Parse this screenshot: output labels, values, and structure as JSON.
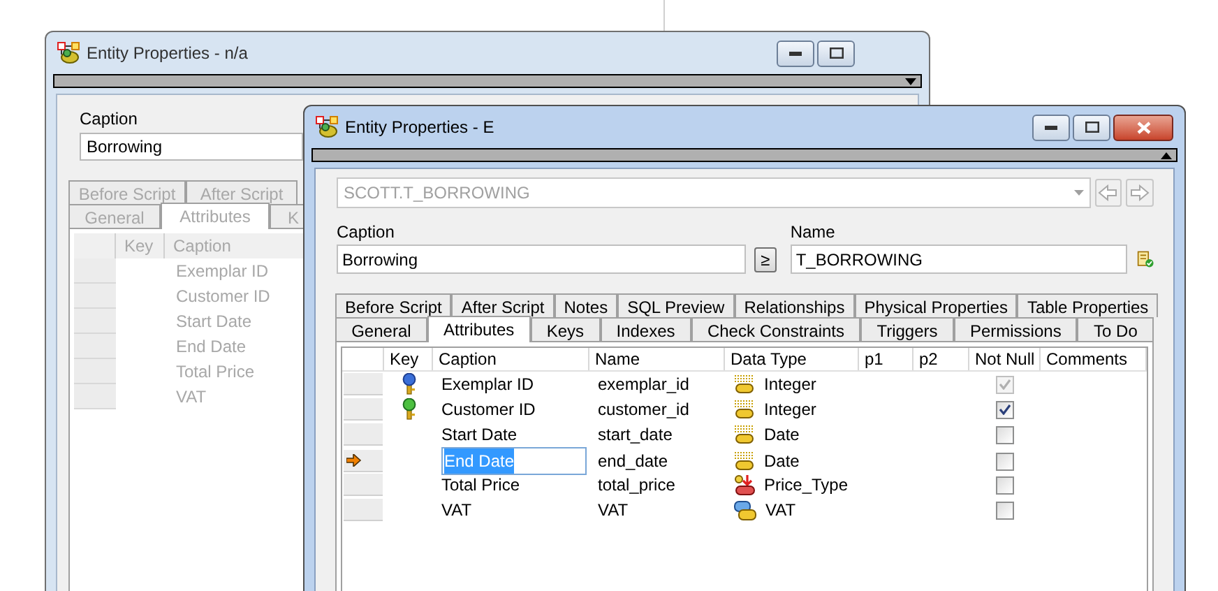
{
  "back_window": {
    "title": "Entity Properties - n/a",
    "active": false,
    "caption": {
      "label": "Caption",
      "value": "Borrowing"
    },
    "tabs_top": [
      {
        "label": "Before Script",
        "selected": false
      },
      {
        "label": "After Script",
        "selected": false
      }
    ],
    "tabs_bottom": [
      {
        "label": "General",
        "selected": false
      },
      {
        "label": "Attributes",
        "selected": true
      },
      {
        "label": "K",
        "selected": false
      }
    ],
    "columns": [
      "Key",
      "Caption"
    ],
    "rows": [
      {
        "caption": "Exemplar ID"
      },
      {
        "caption": "Customer ID"
      },
      {
        "caption": "Start Date"
      },
      {
        "caption": "End Date"
      },
      {
        "caption": "Total Price"
      },
      {
        "caption": "VAT"
      }
    ]
  },
  "front_window": {
    "title": "Entity Properties - E",
    "active": true,
    "object_combo": {
      "value": "SCOTT.T_BORROWING",
      "disabled": true
    },
    "caption": {
      "label": "Caption",
      "value": "Borrowing"
    },
    "copy_button": "≥",
    "name": {
      "label": "Name",
      "value": "T_BORROWING"
    },
    "tabs_top": [
      {
        "label": "Before Script",
        "selected": false
      },
      {
        "label": "After Script",
        "selected": false
      },
      {
        "label": "Notes",
        "selected": false
      },
      {
        "label": "SQL Preview",
        "selected": false
      },
      {
        "label": "Relationships",
        "selected": false
      },
      {
        "label": "Physical Properties",
        "selected": false
      },
      {
        "label": "Table Properties",
        "selected": false
      }
    ],
    "tabs_bottom": [
      {
        "label": "General",
        "selected": false
      },
      {
        "label": "Attributes",
        "selected": true
      },
      {
        "label": "Keys",
        "selected": false
      },
      {
        "label": "Indexes",
        "selected": false
      },
      {
        "label": "Check Constraints",
        "selected": false
      },
      {
        "label": "Triggers",
        "selected": false
      },
      {
        "label": "Permissions",
        "selected": false
      },
      {
        "label": "To Do",
        "selected": false
      }
    ],
    "columns": [
      "Key",
      "Caption",
      "Name",
      "Data Type",
      "p1",
      "p2",
      "Not Null",
      "Comments"
    ],
    "rows": [
      {
        "primary_key": true,
        "foreign_key": false,
        "caption": "Exemplar ID",
        "name": "exemplar_id",
        "kind": "domain",
        "data_type": "Integer",
        "not_null": true,
        "not_null_disabled": true,
        "current": false
      },
      {
        "primary_key": false,
        "foreign_key": true,
        "caption": "Customer ID",
        "name": "customer_id",
        "kind": "domain",
        "data_type": "Integer",
        "not_null": true,
        "not_null_disabled": false,
        "current": false
      },
      {
        "primary_key": false,
        "foreign_key": false,
        "caption": "Start Date",
        "name": "start_date",
        "kind": "domain",
        "data_type": "Date",
        "not_null": false,
        "not_null_disabled": false,
        "current": false
      },
      {
        "primary_key": false,
        "foreign_key": false,
        "caption": "End Date",
        "name": "end_date",
        "kind": "domain",
        "data_type": "Date",
        "not_null": false,
        "not_null_disabled": false,
        "current": true
      },
      {
        "primary_key": false,
        "foreign_key": false,
        "caption": "Total Price",
        "name": "total_price",
        "kind": "user_type",
        "data_type": "Price_Type",
        "not_null": false,
        "not_null_disabled": false,
        "current": false
      },
      {
        "primary_key": false,
        "foreign_key": false,
        "caption": "VAT",
        "name": "VAT",
        "kind": "linked_type",
        "data_type": "VAT",
        "not_null": false,
        "not_null_disabled": false,
        "current": false
      }
    ]
  }
}
